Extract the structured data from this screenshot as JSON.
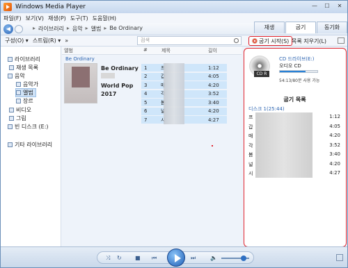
{
  "window": {
    "title": "Windows Media Player"
  },
  "menu": [
    "파일(F)",
    "보기(V)",
    "재생(P)",
    "도구(T)",
    "도움말(H)"
  ],
  "nav": {
    "breadcrumb": [
      "라이브러리",
      "음악",
      "앨범",
      "Be Ordinary"
    ]
  },
  "tabs": [
    "재생",
    "굽기",
    "동기화"
  ],
  "toolbar": {
    "organize": "구성(O)",
    "stream": "스트림(R)",
    "more": "»",
    "search_placeholder": "검색",
    "burn_start": "굽기 시작(S)",
    "clear_list": "목록 지우기(L)"
  },
  "sidebar": {
    "library": "라이브러리",
    "playlists": "재생 목록",
    "music": "음악",
    "artist": "음악가",
    "album": "앨범",
    "genre": "장르",
    "videos": "비디오",
    "pictures": "그림",
    "blank_disc": "빈 디스크 (E:)",
    "other_libraries": "기타 라이브러리"
  },
  "columns": {
    "album": "앨범",
    "number": "#",
    "title": "제목",
    "length": "길이"
  },
  "album": {
    "group_label": "Be Ordinary",
    "title": "Be Ordinary",
    "genre": "World Pop",
    "year": "2017"
  },
  "tracks": [
    {
      "num": "1",
      "title": "프",
      "length": "1:12"
    },
    {
      "num": "2",
      "title": "갑",
      "length": "4:05"
    },
    {
      "num": "3",
      "title": "매",
      "length": "4:20"
    },
    {
      "num": "4",
      "title": "각",
      "length": "3:52"
    },
    {
      "num": "5",
      "title": "봄",
      "length": "3:40"
    },
    {
      "num": "6",
      "title": "널",
      "length": "4:20"
    },
    {
      "num": "7",
      "title": "시",
      "length": "4:27"
    }
  ],
  "burn_panel": {
    "drive_name": "CD 드라이브(E:)",
    "drive_type": "오디오 CD",
    "drive_usage_fraction": 0.68,
    "space_text": "54:13/80분 사용 가능",
    "cd_badge": "CD R",
    "list_title": "굽기 목록",
    "disc_label": "디스크 1(25:44)",
    "items": [
      {
        "title": "프",
        "length": "1:12"
      },
      {
        "title": "갑",
        "length": "4:05"
      },
      {
        "title": "매",
        "length": "4:20"
      },
      {
        "title": "각",
        "length": "3:52"
      },
      {
        "title": "봄",
        "length": "3:40"
      },
      {
        "title": "널",
        "length": "4:20"
      },
      {
        "title": "시",
        "length": "4:27"
      }
    ]
  },
  "playback": {
    "shuffle": "⤨",
    "repeat": "↻",
    "stop": "■",
    "prev": "⏮",
    "next": "⏭",
    "volume_icon": "🔈"
  }
}
